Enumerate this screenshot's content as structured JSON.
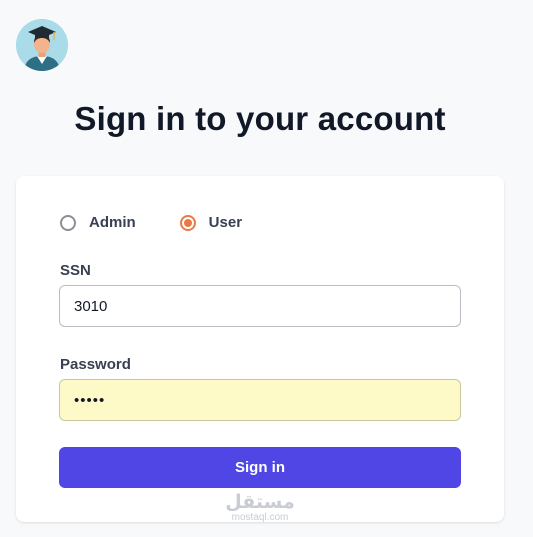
{
  "header": {
    "title": "Sign in to your account",
    "avatar_icon": "graduate-avatar-icon"
  },
  "form": {
    "roles": [
      {
        "label": "Admin",
        "checked": false
      },
      {
        "label": "User",
        "checked": true
      }
    ],
    "ssn": {
      "label": "SSN",
      "value": "3010"
    },
    "password": {
      "label": "Password",
      "value": "•••••"
    },
    "submit_label": "Sign in"
  },
  "watermark": {
    "main": "مستقل",
    "sub": "mostaql.com"
  },
  "colors": {
    "accent_button": "#4f46e5",
    "radio_selected": "#ea7a45",
    "autofill_bg": "#fefac8",
    "page_bg": "#f8f9fb"
  }
}
